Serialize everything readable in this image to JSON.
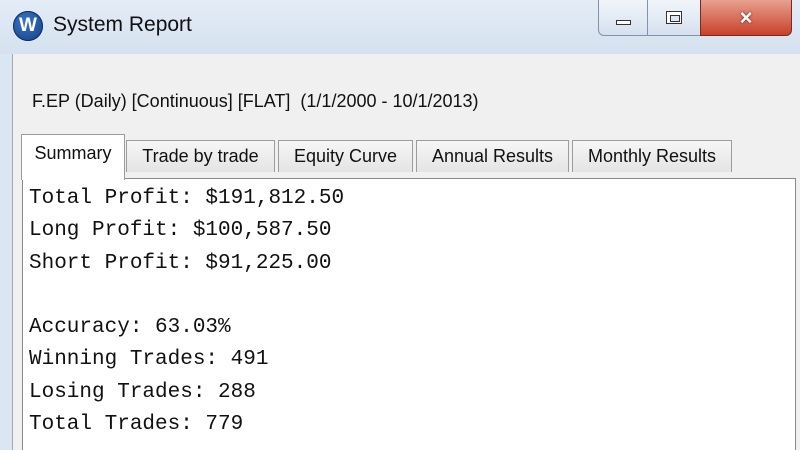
{
  "window": {
    "title": "System Report",
    "app_icon_letter": "W",
    "controls": {
      "minimize": "minimize",
      "maximize": "maximize",
      "close": "×"
    }
  },
  "report": {
    "header": "F.EP (Daily) [Continuous] [FLAT]  (1/1/2000 - 10/1/2013)"
  },
  "tabs": [
    {
      "label": "Summary",
      "active": true
    },
    {
      "label": "Trade by trade",
      "active": false
    },
    {
      "label": "Equity Curve",
      "active": false
    },
    {
      "label": "Annual Results",
      "active": false
    },
    {
      "label": "Monthly Results",
      "active": false
    }
  ],
  "summary": {
    "total_profit": "Total Profit: $191,812.50",
    "long_profit": "Long Profit: $100,587.50",
    "short_profit": "Short Profit: $91,225.00",
    "accuracy": "Accuracy: 63.03%",
    "winning_trades": "Winning Trades: 491",
    "losing_trades": "Losing Trades: 288",
    "total_trades": "Total Trades: 779"
  }
}
